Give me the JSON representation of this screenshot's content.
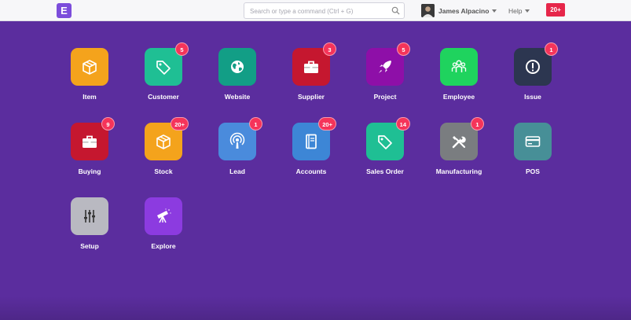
{
  "navbar": {
    "logo_letter": "E",
    "search_placeholder": "Search or type a command (Ctrl + G)",
    "user_name": "James Alpacino",
    "help_label": "Help",
    "notification_count": "20+"
  },
  "modules": [
    {
      "label": "Item",
      "color": "#f4a31c",
      "icon": "box-icon",
      "badge": ""
    },
    {
      "label": "Customer",
      "color": "#1fbf94",
      "icon": "tag-icon",
      "badge": "5"
    },
    {
      "label": "Website",
      "color": "#129e86",
      "icon": "globe-icon",
      "badge": ""
    },
    {
      "label": "Supplier",
      "color": "#c5172f",
      "icon": "briefcase-icon",
      "badge": "3"
    },
    {
      "label": "Project",
      "color": "#8e0fa8",
      "icon": "rocket-icon",
      "badge": "5"
    },
    {
      "label": "Employee",
      "color": "#1fd35e",
      "icon": "people-icon",
      "badge": ""
    },
    {
      "label": "Issue",
      "color": "#2c3650",
      "icon": "alert-icon",
      "badge": "1"
    },
    {
      "label": "Buying",
      "color": "#c5172f",
      "icon": "briefcase-icon",
      "badge": "9"
    },
    {
      "label": "Stock",
      "color": "#f4a31c",
      "icon": "box-icon",
      "badge": "20+"
    },
    {
      "label": "Lead",
      "color": "#4a8bdc",
      "icon": "broadcast-icon",
      "badge": "1"
    },
    {
      "label": "Accounts",
      "color": "#3d86d6",
      "icon": "book-icon",
      "badge": "20+"
    },
    {
      "label": "Sales Order",
      "color": "#1fbf94",
      "icon": "tag-icon",
      "badge": "14"
    },
    {
      "label": "Manufacturing",
      "color": "#7a7d80",
      "icon": "tools-icon",
      "badge": "1"
    },
    {
      "label": "POS",
      "color": "#478f97",
      "icon": "credit-card-icon",
      "badge": ""
    },
    {
      "label": "Setup",
      "color": "#b9b9c1",
      "icon": "sliders-icon",
      "badge": ""
    },
    {
      "label": "Explore",
      "color": "#8c3be0",
      "icon": "telescope-icon",
      "badge": ""
    }
  ]
}
